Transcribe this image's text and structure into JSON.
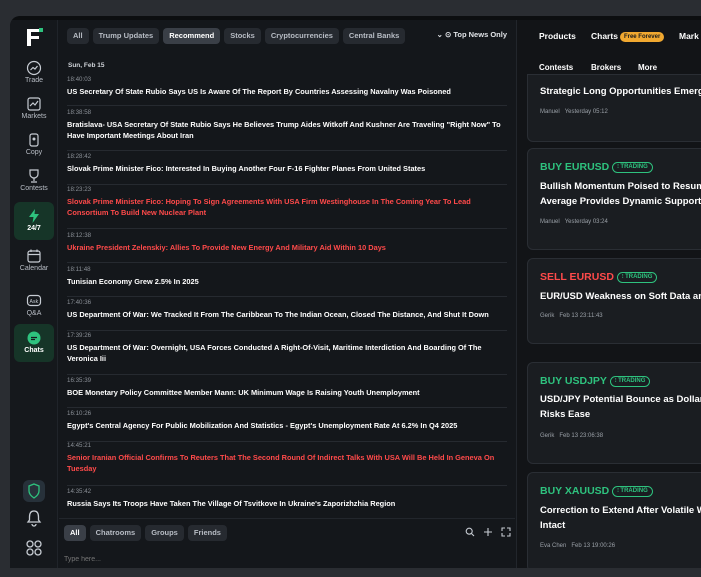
{
  "sidebar": {
    "items": [
      {
        "label": "Trade",
        "icon": "trade-icon"
      },
      {
        "label": "Markets",
        "icon": "markets-icon"
      },
      {
        "label": "Copy",
        "icon": "copy-icon"
      },
      {
        "label": "Contests",
        "icon": "contests-icon"
      },
      {
        "label": "24/7",
        "icon": "bolt-icon"
      },
      {
        "label": "Calendar",
        "icon": "calendar-icon"
      },
      {
        "label": "Q&A",
        "icon": "qa-icon"
      },
      {
        "label": "Chats",
        "icon": "chat-icon"
      }
    ]
  },
  "news": {
    "filters": [
      "All",
      "Trump Updates",
      "Recommend",
      "Stocks",
      "Cryptocurrencies",
      "Central Banks"
    ],
    "active_filter": "Recommend",
    "top_news_only": "Top News Only",
    "date": "Sun, Feb 15",
    "items": [
      {
        "time": "18:40:03",
        "headline": "US Secretary Of State Rubio Says US Is Aware Of The Report By Countries Assessing Navalny Was Poisoned",
        "red": false
      },
      {
        "time": "18:38:58",
        "headline": "Bratislava- USA Secretary Of State Rubio Says He Believes Trump Aides Witkoff And Kushner Are Traveling \"Right Now\" To Have Important Meetings About Iran",
        "red": false
      },
      {
        "time": "18:28:42",
        "headline": "Slovak Prime Minister Fico: Interested In Buying Another Four F-16 Fighter Planes From United States",
        "red": false
      },
      {
        "time": "18:23:23",
        "headline": "Slovak Prime Minister Fico: Hoping To Sign Agreements With USA Firm Westinghouse In The Coming Year To Lead Consortium To Build New Nuclear Plant",
        "red": true
      },
      {
        "time": "18:12:38",
        "headline": "Ukraine President Zelenskiy: Allies To Provide New Energy And Military Aid Within 10 Days",
        "red": true
      },
      {
        "time": "18:11:48",
        "headline": "Tunisian Economy Grew 2.5% In 2025",
        "red": false
      },
      {
        "time": "17:40:36",
        "headline": "US Department Of War: We Tracked It From The Caribbean To The Indian Ocean, Closed The Distance, And Shut It Down",
        "red": false
      },
      {
        "time": "17:39:26",
        "headline": "US Department Of War: Overnight, USA Forces Conducted A Right-Of-Visit, Maritime Interdiction And Boarding Of The Veronica Iii",
        "red": false
      },
      {
        "time": "16:35:39",
        "headline": "BOE Monetary Policy Committee Member Mann: UK Minimum Wage Is Raising Youth Unemployment",
        "red": false
      },
      {
        "time": "16:10:26",
        "headline": "Egypt's Central Agency For Public Mobilization And Statistics - Egypt's Unemployment Rate At 6.2% In Q4 2025",
        "red": false
      },
      {
        "time": "14:45:21",
        "headline": "Senior Iranian Official Confirms To Reuters That The Second Round Of Indirect Talks With USA Will Be Held In Geneva On Tuesday",
        "red": true
      },
      {
        "time": "14:35:42",
        "headline": "Russia Says Its Troops Have Taken The Village Of Tsvitkove In Ukraine's Zaporizhzhia Region",
        "red": false
      }
    ]
  },
  "chat": {
    "tabs": [
      "All",
      "Chatrooms",
      "Groups",
      "Friends"
    ],
    "active_tab": "All",
    "placeholder": "Type here..."
  },
  "right": {
    "topnav": [
      "Products",
      "Charts",
      "Mark"
    ],
    "free_badge": "Free Forever",
    "subnav": [
      "Contests",
      "Brokers",
      "More"
    ],
    "cards": [
      {
        "signal": "",
        "badge": "",
        "title_lines": [
          "Strategic Long Opportunities Emerg"
        ],
        "author": "Manuel",
        "time": "Yesterday 05:12"
      },
      {
        "signal": "BUY EURUSD",
        "type": "buy",
        "badge": "TRADING",
        "title_lines": [
          "Bullish Momentum Poised to Resume",
          "Average Provides Dynamic Support"
        ],
        "author": "Manuel",
        "time": "Yesterday 03:24"
      },
      {
        "signal": "SELL EURUSD",
        "type": "sell",
        "badge": "TRADING",
        "title_lines": [
          "EUR/USD Weakness on Soft Data an"
        ],
        "author": "Gerik",
        "time": "Feb 13 23:11:43"
      },
      {
        "signal": "BUY USDJPY",
        "type": "buy",
        "badge": "TRADING",
        "title_lines": [
          "USD/JPY Potential Bounce as Dollar",
          "Risks Ease"
        ],
        "author": "Gerik",
        "time": "Feb 13 23:06:38"
      },
      {
        "signal": "BUY XAUUSD",
        "type": "buy",
        "badge": "TRADING",
        "title_lines": [
          "Correction to Extend After Volatile W",
          "Intact"
        ],
        "author": "Eva Chen",
        "time": "Feb 13 19:00:26"
      }
    ]
  },
  "colors": {
    "accent_green": "#2ec27e",
    "alert_red": "#ff4a4a",
    "free_badge": "#f0a830"
  }
}
